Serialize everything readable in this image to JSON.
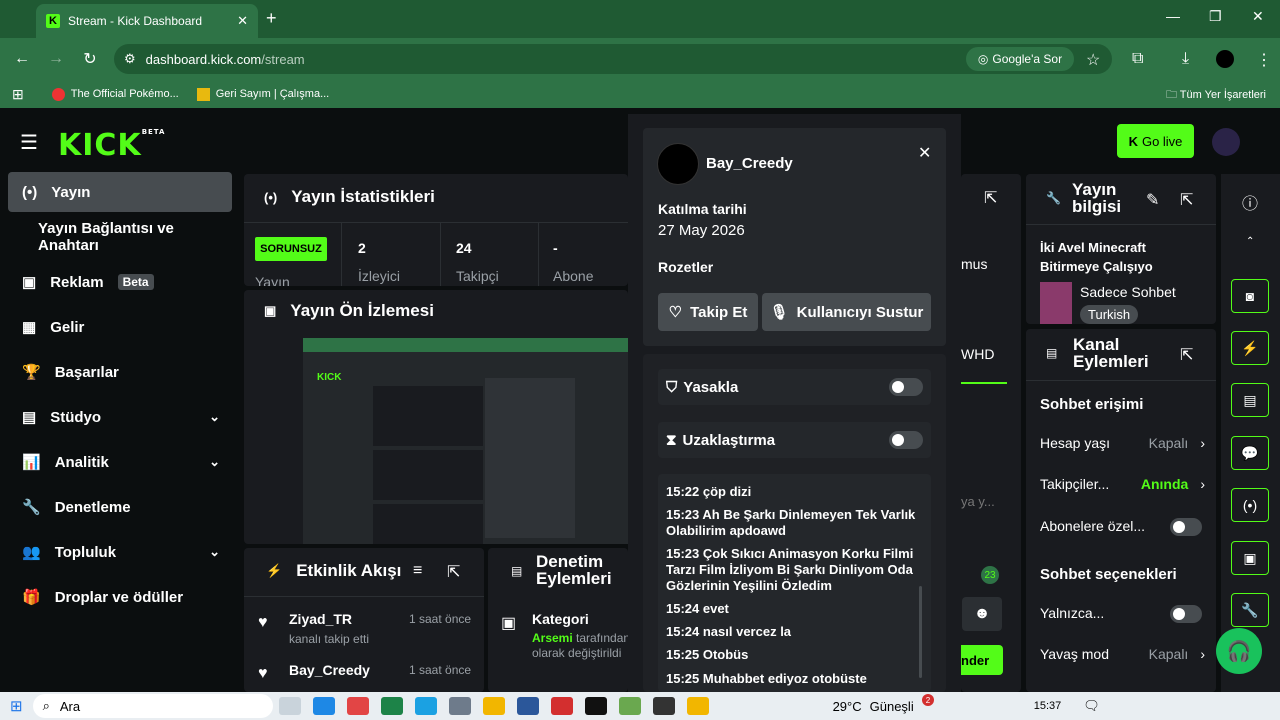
{
  "browser": {
    "tab_title": "Stream - Kick Dashboard",
    "url_host": "dashboard.kick.com",
    "url_path": "/stream",
    "ask_google": "Google'a Sor",
    "bookmarks": [
      "The Official Pokémo...",
      "Geri Sayım | Çalışma..."
    ],
    "all_bookmarks": "Tüm Yer İşaretleri"
  },
  "kick": {
    "logo": "KICK",
    "logo_beta": "BETA",
    "go_live": "Go live",
    "sidebar": [
      {
        "label": "Yayın"
      },
      {
        "label": "Yayın Bağlantısı ve Anahtarı"
      },
      {
        "label": "Reklam",
        "badge": "Beta"
      },
      {
        "label": "Gelir"
      },
      {
        "label": "Başarılar"
      },
      {
        "label": "Stüdyo"
      },
      {
        "label": "Analitik"
      },
      {
        "label": "Denetleme"
      },
      {
        "label": "Topluluk"
      },
      {
        "label": "Droplar ve ödüller"
      }
    ]
  },
  "stats": {
    "title": "Yayın İstatistikleri",
    "status_badge": "SORUNSUZ",
    "status_label": "Yayın",
    "viewers": "2",
    "viewers_label": "İzleyici",
    "followers": "24",
    "followers_label": "Takipçi",
    "subs": "-",
    "subs_label": "Abone"
  },
  "preview": {
    "title": "Yayın Ön İzlemesi"
  },
  "activity": {
    "title": "Etkinlik Akışı",
    "items": [
      {
        "name": "Ziyad_TR",
        "sub": "kanalı takip etti",
        "time": "1 saat önce"
      },
      {
        "name": "Bay_Creedy",
        "sub": "",
        "time": "1 saat önce"
      }
    ]
  },
  "modactions": {
    "title": "Denetim Eylemleri",
    "item_title": "Kategori",
    "item_user": "Arsemi",
    "item_sub1": " tarafından",
    "item_sub2": "olarak değiştirildi"
  },
  "popup": {
    "username": "Bay_Creedy",
    "joined_label": "Katılma tarihi",
    "joined_date": "27 May 2026",
    "badges_label": "Rozetler",
    "follow": "Takip Et",
    "mute": "Kullanıcıyı Sustur",
    "ban": "Yasakla",
    "timeout": "Uzaklaştırma",
    "messages": [
      "15:22 çöp dizi",
      "15:23 Ah Be Şarkı Dinlemeyen Tek Varlık Olabilirim apdoawd",
      "15:23 Çok Sıkıcı Animasyon Korku Filmi Tarzı Film İzliyom Bi Şarkı Dinliyom Oda Gözlerinin Yeşilini Özledim",
      "15:24 evet",
      "15:24 nasıl vercez la",
      "15:25 Otobüs",
      "15:25 Muhabbet ediyoz otobüste"
    ]
  },
  "partial": {
    "mus": "mus",
    "whd": "WHD",
    "placeholder": "ya y...",
    "count": "23",
    "send": "nder"
  },
  "streaminfo": {
    "title": "Yayın bilgisi",
    "stream_title": "İki Avel Minecraft Bitirmeye Çalışıyo",
    "category": "Sadece Sohbet",
    "language": "Turkish"
  },
  "channel": {
    "title": "Kanal Eylemleri",
    "chat_access": "Sohbet erişimi",
    "account_age": "Hesap yaşı",
    "account_age_val": "Kapalı",
    "followers": "Takipçiler...",
    "followers_val": "Anında",
    "subs_only": "Abonelere özel...",
    "chat_options": "Sohbet seçenekleri",
    "only": "Yalnızca...",
    "slow": "Yavaş mod",
    "slow_val": "Kapalı"
  },
  "taskbar": {
    "search": "Ara",
    "weather": "29°C",
    "weather_desc": "Güneşli",
    "clock": "15:37",
    "notif": "2"
  }
}
